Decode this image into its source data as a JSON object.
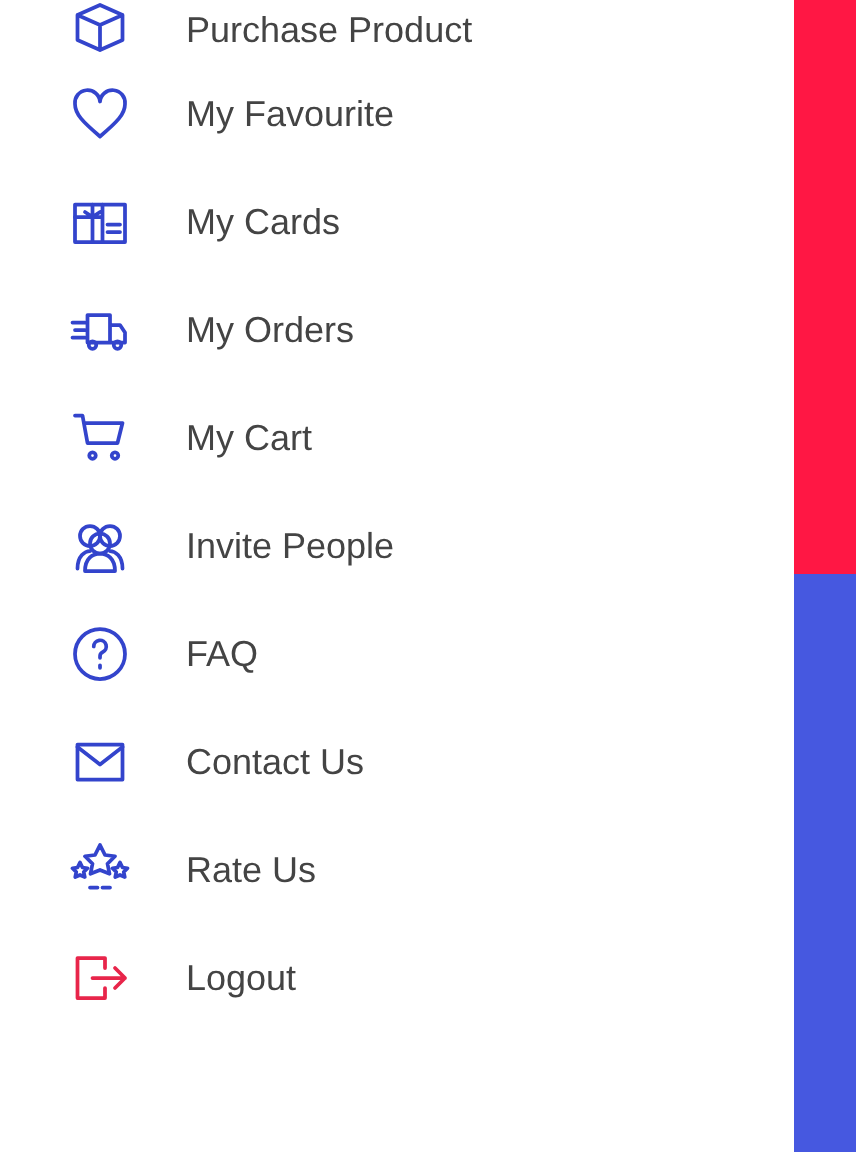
{
  "menu": {
    "items": [
      {
        "label": "Purchase Product",
        "kind": "box",
        "color": "#3344cc"
      },
      {
        "label": "My Favourite",
        "kind": "heart",
        "color": "#3344cc"
      },
      {
        "label": "My Cards",
        "kind": "card",
        "color": "#3344cc"
      },
      {
        "label": "My Orders",
        "kind": "truck",
        "color": "#3344cc"
      },
      {
        "label": "My Cart",
        "kind": "cart",
        "color": "#3344cc"
      },
      {
        "label": "Invite People",
        "kind": "people",
        "color": "#3344cc"
      },
      {
        "label": "FAQ",
        "kind": "question",
        "color": "#3344cc"
      },
      {
        "label": "Contact Us",
        "kind": "mail",
        "color": "#3344cc"
      },
      {
        "label": "Rate Us",
        "kind": "stars",
        "color": "#3344cc"
      },
      {
        "label": "Logout",
        "kind": "logout",
        "color": "#e8254a"
      }
    ]
  },
  "background_panels": [
    {
      "color": "#ff1744"
    },
    {
      "color": "#4658e0"
    }
  ]
}
